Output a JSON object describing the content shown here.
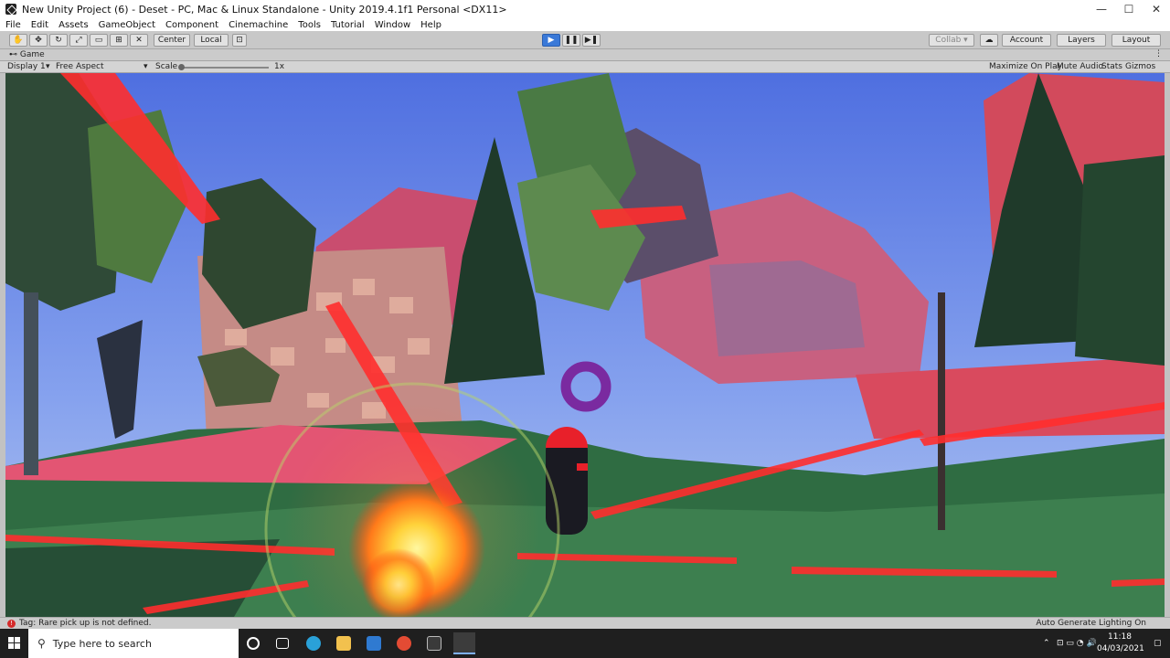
{
  "window": {
    "title": "New Unity Project (6) - Deset - PC, Mac & Linux Standalone - Unity 2019.4.1f1 Personal <DX11>",
    "controls": [
      "—",
      "☐",
      "✕"
    ]
  },
  "menu": [
    "File",
    "Edit",
    "Assets",
    "GameObject",
    "Component",
    "Cinemachine",
    "Tools",
    "Tutorial",
    "Window",
    "Help"
  ],
  "toolbar": {
    "pivot_label": "Center",
    "space_label": "Local",
    "collab_label": "Collab ▾",
    "account_label": "Account",
    "layers_label": "Layers",
    "layout_label": "Layout"
  },
  "game_view": {
    "tab_label": "Game",
    "display_label": "Display 1",
    "aspect_label": "Free Aspect",
    "scale_label": "Scale",
    "scale_value": "1x",
    "maximize_label": "Maximize On Play",
    "mute_label": "Mute Audio",
    "stats_label": "Stats",
    "gizmos_label": "Gizmos"
  },
  "status": {
    "error_message": "Tag: Rare pick up is not defined.",
    "right_text": "Auto Generate Lighting On"
  },
  "taskbar": {
    "search_placeholder": "Type here to search",
    "time": "11:18",
    "date": "04/03/2021"
  }
}
